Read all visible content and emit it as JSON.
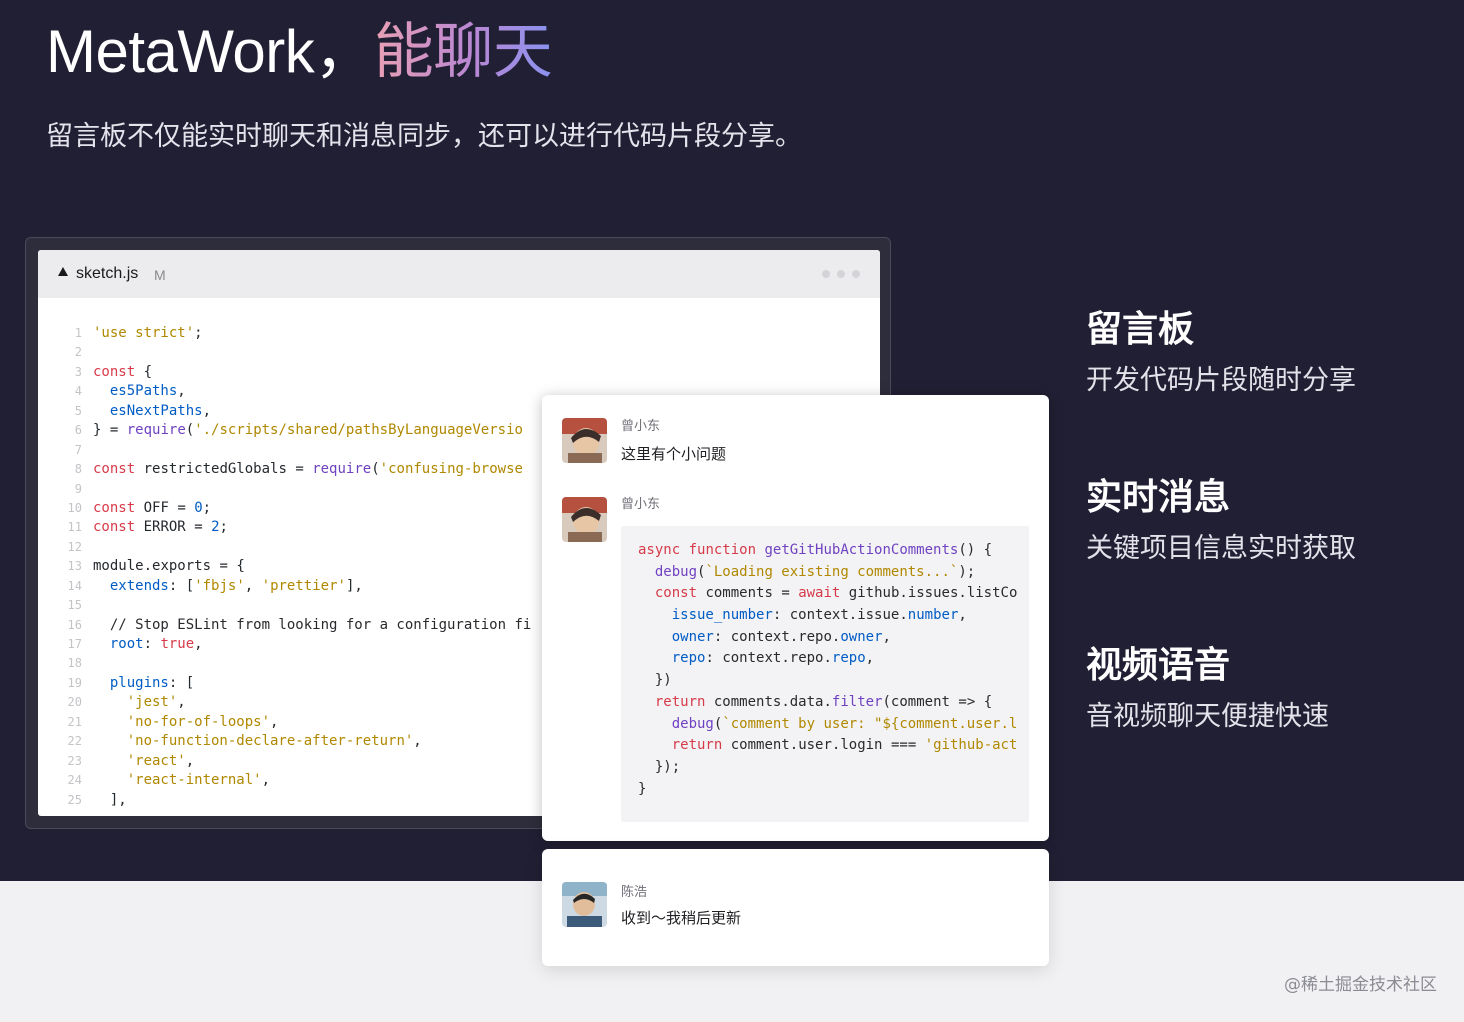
{
  "header": {
    "title_prefix": "MetaWork，",
    "title_accent": "能聊天",
    "subtitle": "留言板不仅能实时聊天和消息同步，还可以进行代码片段分享。"
  },
  "editor": {
    "file_name": "sketch.js",
    "file_status": "M",
    "lines": [
      {
        "n": "1",
        "t": "'use strict';"
      },
      {
        "n": "2",
        "t": ""
      },
      {
        "n": "3",
        "t": "const {"
      },
      {
        "n": "4",
        "t": "  es5Paths,"
      },
      {
        "n": "5",
        "t": "  esNextPaths,"
      },
      {
        "n": "6",
        "t": "} = require('./scripts/shared/pathsByLanguageVersio"
      },
      {
        "n": "7",
        "t": ""
      },
      {
        "n": "8",
        "t": "const restrictedGlobals = require('confusing-browse"
      },
      {
        "n": "9",
        "t": ""
      },
      {
        "n": "10",
        "t": "const OFF = 0;"
      },
      {
        "n": "11",
        "t": "const ERROR = 2;"
      },
      {
        "n": "12",
        "t": ""
      },
      {
        "n": "13",
        "t": "module.exports = {"
      },
      {
        "n": "14",
        "t": "  extends: ['fbjs', 'prettier'],"
      },
      {
        "n": "15",
        "t": ""
      },
      {
        "n": "16",
        "t": "  // Stop ESLint from looking for a configuration fi"
      },
      {
        "n": "17",
        "t": "  root: true,"
      },
      {
        "n": "18",
        "t": ""
      },
      {
        "n": "19",
        "t": "  plugins: ["
      },
      {
        "n": "20",
        "t": "    'jest',"
      },
      {
        "n": "21",
        "t": "    'no-for-of-loops',"
      },
      {
        "n": "22",
        "t": "    'no-function-declare-after-return',"
      },
      {
        "n": "23",
        "t": "    'react',"
      },
      {
        "n": "24",
        "t": "    'react-internal',"
      },
      {
        "n": "25",
        "t": "  ],"
      }
    ]
  },
  "chat": {
    "messages": [
      {
        "author": "曾小东",
        "text": "这里有个小问题"
      },
      {
        "author": "曾小东"
      },
      {
        "author": "陈浩",
        "text": "收到～我稍后更新"
      }
    ],
    "snippet_lines": [
      "async function getGitHubActionComments() {",
      "  debug(`Loading existing comments...`);",
      "  const comments = await github.issues.listCo",
      "    issue_number: context.issue.number,",
      "    owner: context.repo.owner,",
      "    repo: context.repo.repo,",
      "  })",
      "  return comments.data.filter(comment => {",
      "    debug(`comment by user: \"${comment.user.l",
      "    return comment.user.login === 'github-act",
      "  });",
      "}"
    ]
  },
  "features": [
    {
      "title": "留言板",
      "desc": "开发代码片段随时分享"
    },
    {
      "title": "实时消息",
      "desc": "关键项目信息实时获取"
    },
    {
      "title": "视频语音",
      "desc": "音视频聊天便捷快速"
    }
  ],
  "watermark": "@稀土掘金技术社区",
  "colors": {
    "background_dark": "#211f33",
    "background_light": "#f1f1f4",
    "accent_gradient": [
      "#e9a0b4",
      "#b987d3",
      "#8a92f0"
    ],
    "code_keyword": "#d73a49",
    "code_string": "#b08800",
    "code_function": "#6f42c1",
    "code_variable": "#005cc5"
  },
  "icons": [
    "triangle-file-icon",
    "window-dots-icon",
    "avatar-image"
  ]
}
